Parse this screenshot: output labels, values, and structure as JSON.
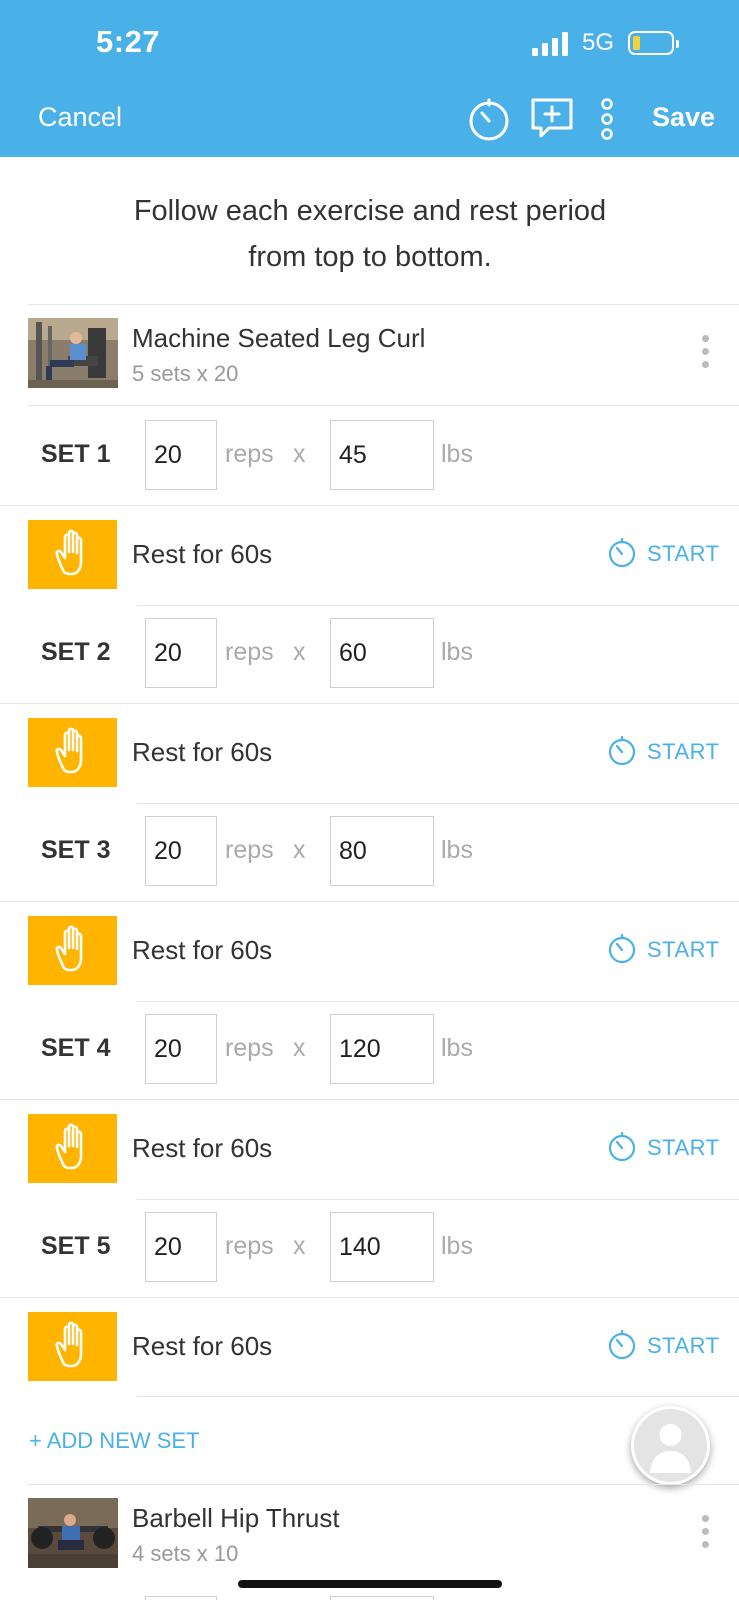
{
  "status_bar": {
    "time": "5:27",
    "network": "5G"
  },
  "nav": {
    "cancel_label": "Cancel",
    "save_label": "Save"
  },
  "instructions": {
    "line1": "Follow each exercise and rest period",
    "line2": "from top to bottom."
  },
  "exercises": [
    {
      "name": "Machine Seated Leg Curl",
      "summary": "5 sets x 20",
      "sets": [
        {
          "label": "SET 1",
          "reps": "20",
          "weight": "45"
        },
        {
          "label": "SET 2",
          "reps": "20",
          "weight": "60"
        },
        {
          "label": "SET 3",
          "reps": "20",
          "weight": "80"
        },
        {
          "label": "SET 4",
          "reps": "20",
          "weight": "120"
        },
        {
          "label": "SET 5",
          "reps": "20",
          "weight": "140"
        }
      ],
      "rest_label": "Rest for 60s"
    },
    {
      "name": "Barbell Hip Thrust",
      "summary": "4 sets x 10"
    }
  ],
  "set_units": {
    "reps": "reps",
    "times": "x",
    "weight": "lbs"
  },
  "start_label": "START",
  "add_set_label": "+ ADD NEW SET",
  "colors": {
    "header": "#4AB0E8",
    "rest": "#FFB400",
    "accent": "#4AB0E8"
  },
  "icons": {
    "timer": "stopwatch-icon",
    "comment": "add-note-icon",
    "more": "vertical-dots-icon",
    "rest": "hand-icon",
    "coach": "person-avatar-icon"
  }
}
